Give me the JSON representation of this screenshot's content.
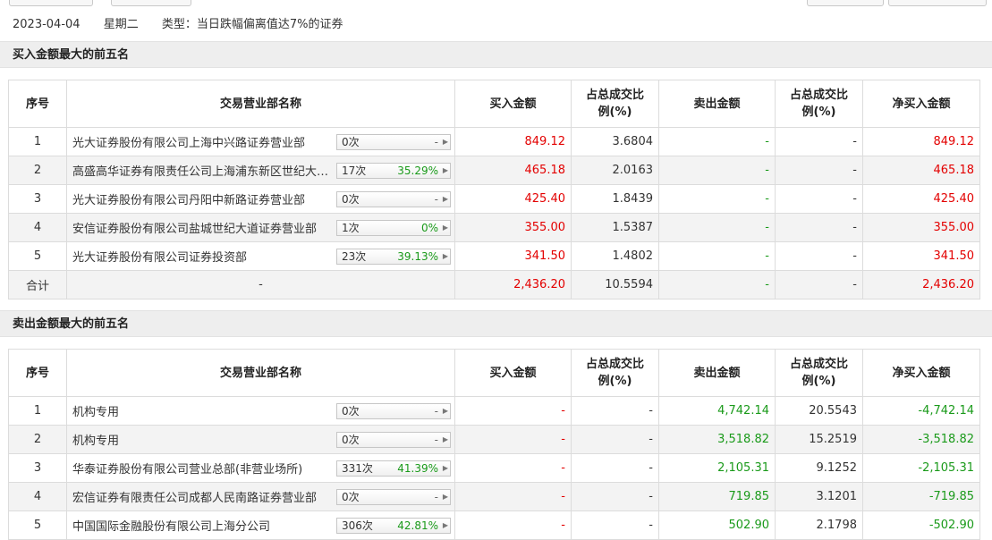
{
  "info": {
    "date": "2023-04-04",
    "weekday": "星期二",
    "type": "类型：当日跌幅偏离值达7%的证券"
  },
  "headers": [
    "序号",
    "交易营业部名称",
    "买入金额",
    "占总成交比例(%)",
    "卖出金额",
    "占总成交比例(%)",
    "净买入金额"
  ],
  "buy": {
    "title": "买入金额最大的前五名",
    "rows": [
      {
        "no": "1",
        "name": "光大证券股份有限公司上海中兴路证券营业部",
        "times": "0次",
        "pct": "-",
        "buy": "849.12",
        "buy_pct": "3.6804",
        "sell": "-",
        "sell_pct": "-",
        "net": "849.12"
      },
      {
        "no": "2",
        "name": "高盛高华证券有限责任公司上海浦东新区世纪大道证券营业部",
        "times": "17次",
        "pct": "35.29%",
        "buy": "465.18",
        "buy_pct": "2.0163",
        "sell": "-",
        "sell_pct": "-",
        "net": "465.18"
      },
      {
        "no": "3",
        "name": "光大证券股份有限公司丹阳中新路证券营业部",
        "times": "0次",
        "pct": "-",
        "buy": "425.40",
        "buy_pct": "1.8439",
        "sell": "-",
        "sell_pct": "-",
        "net": "425.40"
      },
      {
        "no": "4",
        "name": "安信证券股份有限公司盐城世纪大道证券营业部",
        "times": "1次",
        "pct": "0%",
        "buy": "355.00",
        "buy_pct": "1.5387",
        "sell": "-",
        "sell_pct": "-",
        "net": "355.00"
      },
      {
        "no": "5",
        "name": "光大证券股份有限公司证券投资部",
        "times": "23次",
        "pct": "39.13%",
        "buy": "341.50",
        "buy_pct": "1.4802",
        "sell": "-",
        "sell_pct": "-",
        "net": "341.50"
      }
    ],
    "total": {
      "label": "合计",
      "name": "-",
      "buy": "2,436.20",
      "buy_pct": "10.5594",
      "sell": "-",
      "sell_pct": "-",
      "net": "2,436.20"
    }
  },
  "sell": {
    "title": "卖出金额最大的前五名",
    "rows": [
      {
        "no": "1",
        "name": "机构专用",
        "times": "0次",
        "pct": "-",
        "buy": "-",
        "buy_pct": "-",
        "sell": "4,742.14",
        "sell_pct": "20.5543",
        "net": "-4,742.14"
      },
      {
        "no": "2",
        "name": "机构专用",
        "times": "0次",
        "pct": "-",
        "buy": "-",
        "buy_pct": "-",
        "sell": "3,518.82",
        "sell_pct": "15.2519",
        "net": "-3,518.82"
      },
      {
        "no": "3",
        "name": "华泰证券股份有限公司营业总部(非营业场所)",
        "times": "331次",
        "pct": "41.39%",
        "buy": "-",
        "buy_pct": "-",
        "sell": "2,105.31",
        "sell_pct": "9.1252",
        "net": "-2,105.31"
      },
      {
        "no": "4",
        "name": "宏信证券有限责任公司成都人民南路证券营业部",
        "times": "0次",
        "pct": "-",
        "buy": "-",
        "buy_pct": "-",
        "sell": "719.85",
        "sell_pct": "3.1201",
        "net": "-719.85"
      },
      {
        "no": "5",
        "name": "中国国际金融股份有限公司上海分公司",
        "times": "306次",
        "pct": "42.81%",
        "buy": "-",
        "buy_pct": "-",
        "sell": "502.90",
        "sell_pct": "2.1798",
        "net": "-502.90"
      }
    ]
  },
  "colors": {
    "up": "#e30000",
    "down": "#1a9a1a",
    "header_bg": "#eeeeee"
  }
}
